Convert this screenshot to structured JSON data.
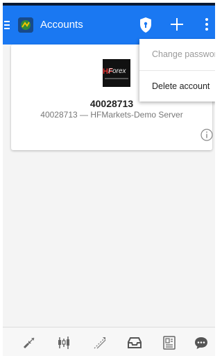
{
  "appbar": {
    "title": "Accounts",
    "icons": [
      "hamburger-menu-icon",
      "app-logo-icon",
      "shield-icon",
      "plus-icon",
      "more-vert-icon"
    ]
  },
  "account": {
    "number": "40028713",
    "server_line": "40028713 — HFMarkets-Demo Server",
    "broker_logo_text": "HFForex"
  },
  "overflow_menu": {
    "change_password": "Change password",
    "delete_account": "Delete account"
  },
  "bottom_nav": [
    "quotes-icon",
    "chart-icon",
    "trade-icon",
    "history-icon",
    "journal-icon",
    "messages-icon"
  ],
  "colors": {
    "appbar": "#1a78f2",
    "background": "#f4f4f4"
  }
}
